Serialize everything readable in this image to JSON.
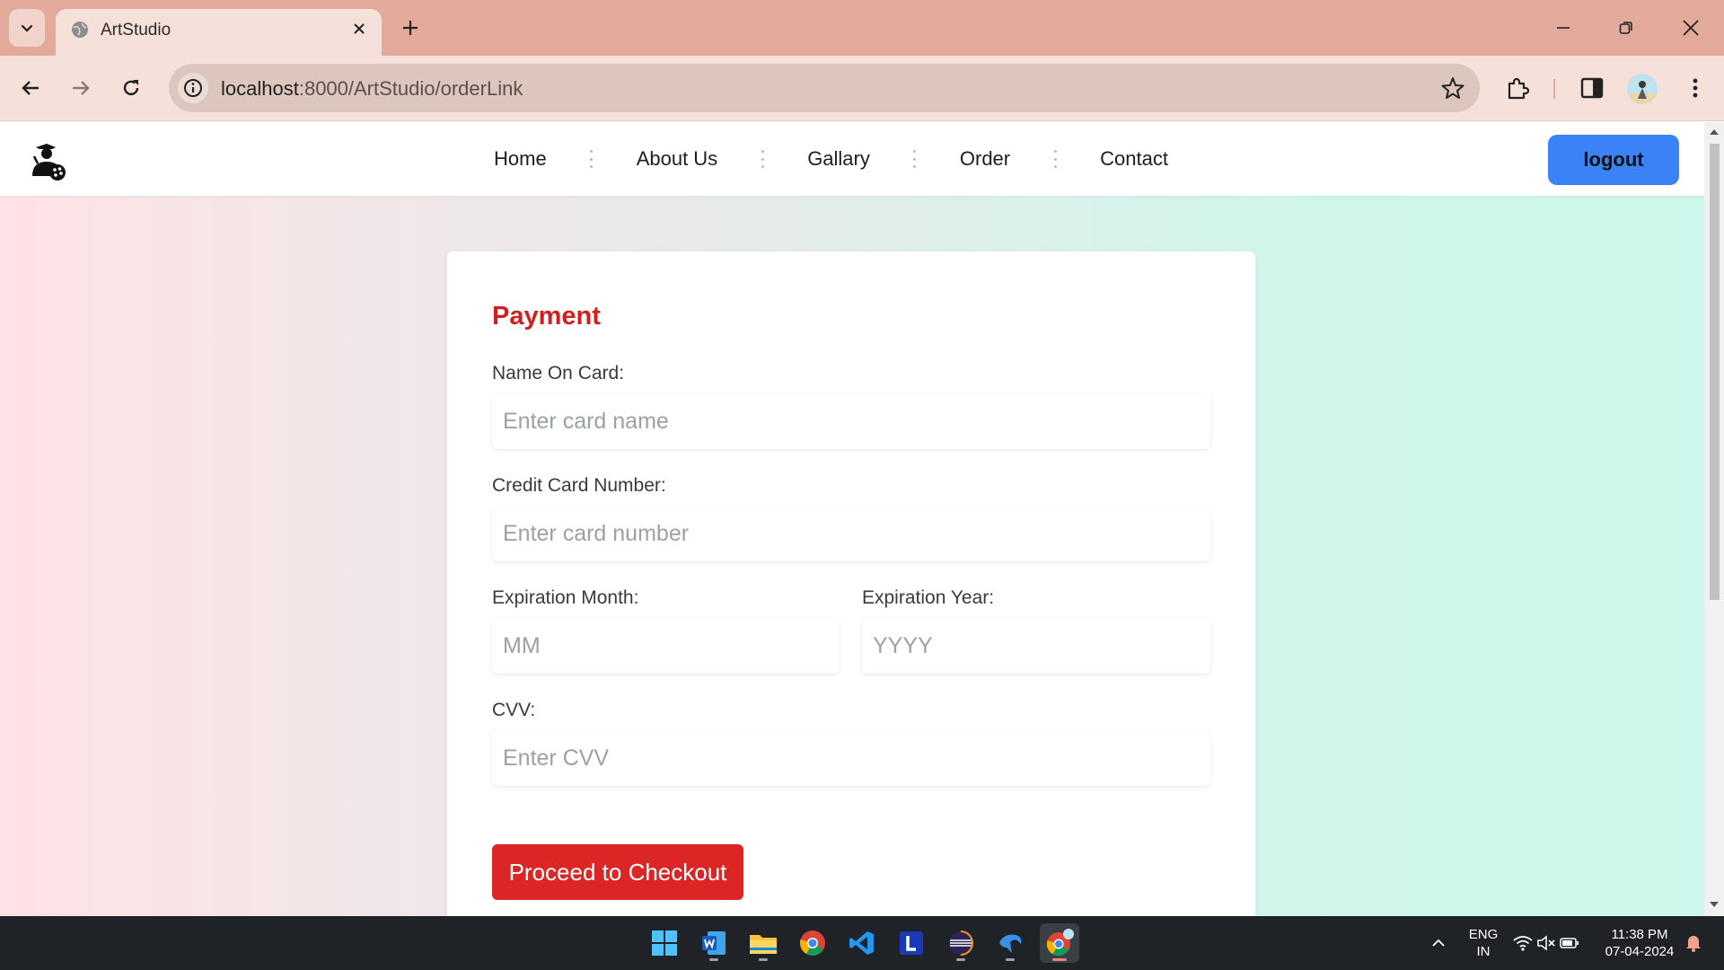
{
  "browser": {
    "tab_title": "ArtStudio",
    "url_host": "localhost",
    "url_path": ":8000/ArtStudio/orderLink"
  },
  "nav": {
    "items": [
      "Home",
      "About Us",
      "Gallary",
      "Order",
      "Contact"
    ],
    "logout_label": "logout"
  },
  "payment": {
    "title": "Payment",
    "name_label": "Name On Card:",
    "name_placeholder": "Enter card name",
    "card_label": "Credit Card Number:",
    "card_placeholder": "Enter card number",
    "month_label": "Expiration Month:",
    "month_placeholder": "MM",
    "year_label": "Expiration Year:",
    "year_placeholder": "YYYY",
    "cvv_label": "CVV:",
    "cvv_placeholder": "Enter CVV",
    "checkout_label": "Proceed to Checkout"
  },
  "taskbar": {
    "lang": "ENG",
    "region": "IN",
    "time": "11:38 PM",
    "date": "07-04-2024"
  },
  "colors": {
    "accent_red": "#dc2626",
    "logout_blue": "#3b82f6",
    "tab_strip": "#e3a99b"
  }
}
